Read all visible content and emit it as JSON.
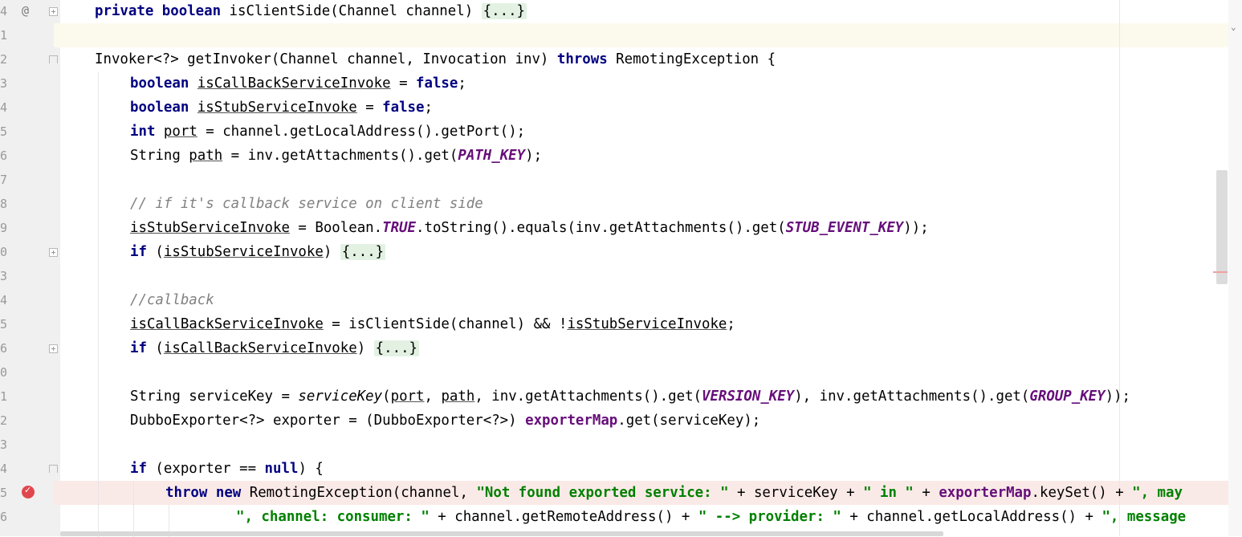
{
  "editor": {
    "line_numbers": [
      "4",
      "1",
      "2",
      "3",
      "4",
      "5",
      "6",
      "7",
      "8",
      "9",
      "0",
      "3",
      "4",
      "5",
      "6",
      "0",
      "1",
      "2",
      "3",
      "4",
      "5",
      "6"
    ],
    "annotation_glyph": "@",
    "breakpoint_glyph": "✓",
    "scroll_glyph": "⌄"
  },
  "code": {
    "l00": {
      "kw1": "private",
      "kw2": "boolean",
      "text": " isClientSide(Channel channel) ",
      "fold": "{...}"
    },
    "l02": {
      "text1": "Invoker<?> getInvoker(Channel channel, Invocation inv) ",
      "kw": "throws",
      "text2": " RemotingException {"
    },
    "l03": {
      "kw": "boolean",
      "var": "isCallBackServiceInvoke",
      "eq": " = ",
      "val": "false",
      "semi": ";"
    },
    "l04": {
      "kw": "boolean",
      "var": "isStubServiceInvoke",
      "eq": " = ",
      "val": "false",
      "semi": ";"
    },
    "l05": {
      "kw": "int",
      "var": "port",
      "rest": " = channel.getLocalAddress().getPort();"
    },
    "l06": {
      "text1": "String ",
      "var": "path",
      "text2": " = inv.getAttachments().get(",
      "const": "PATH_KEY",
      "text3": ");"
    },
    "l08": {
      "comment": "// if it's callback service on client side"
    },
    "l09": {
      "var": "isStubServiceInvoke",
      "text1": " = Boolean.",
      "const": "TRUE",
      "text2": ".toString().equals(inv.getAttachments().get(",
      "const2": "STUB_EVENT_KEY",
      "text3": "));"
    },
    "l10": {
      "kw": "if",
      "text1": " (",
      "var": "isStubServiceInvoke",
      "text2": ") ",
      "fold": "{...}"
    },
    "l12": {
      "comment": "//callback"
    },
    "l13": {
      "var": "isCallBackServiceInvoke",
      "text1": " = isClientSide(channel) && !",
      "var2": "isStubServiceInvoke",
      "text2": ";"
    },
    "l14": {
      "kw": "if",
      "text1": " (",
      "var": "isCallBackServiceInvoke",
      "text2": ") ",
      "fold": "{...}"
    },
    "l16": {
      "text1": "String serviceKey = ",
      "method": "serviceKey",
      "text2": "(",
      "var1": "port",
      "text3": ", ",
      "var2": "path",
      "text4": ", inv.getAttachments().get(",
      "const1": "VERSION_KEY",
      "text5": "), inv.getAttachments().get(",
      "const2": "GROUP_KEY",
      "text6": "));"
    },
    "l17": {
      "text1": "DubboExporter<?> exporter = (DubboExporter<?>) ",
      "field": "exporterMap",
      "text2": ".get(serviceKey);"
    },
    "l19": {
      "kw1": "if",
      "text1": " (exporter == ",
      "kw2": "null",
      "text2": ") {"
    },
    "l20": {
      "kw1": "throw",
      "sp": " ",
      "kw2": "new",
      "text1": " RemotingException(channel, ",
      "str1": "\"Not found exported service: \"",
      "text2": " + serviceKey + ",
      "str2": "\" in \"",
      "text3": " + ",
      "field": "exporterMap",
      "text4": ".keySet() + ",
      "str3": "\", may"
    },
    "l21": {
      "str1": "\", channel: consumer: \"",
      "text1": " + channel.getRemoteAddress() + ",
      "str2": "\" --> provider: \"",
      "text2": " + channel.getLocalAddress() + ",
      "str3": "\", message"
    }
  }
}
